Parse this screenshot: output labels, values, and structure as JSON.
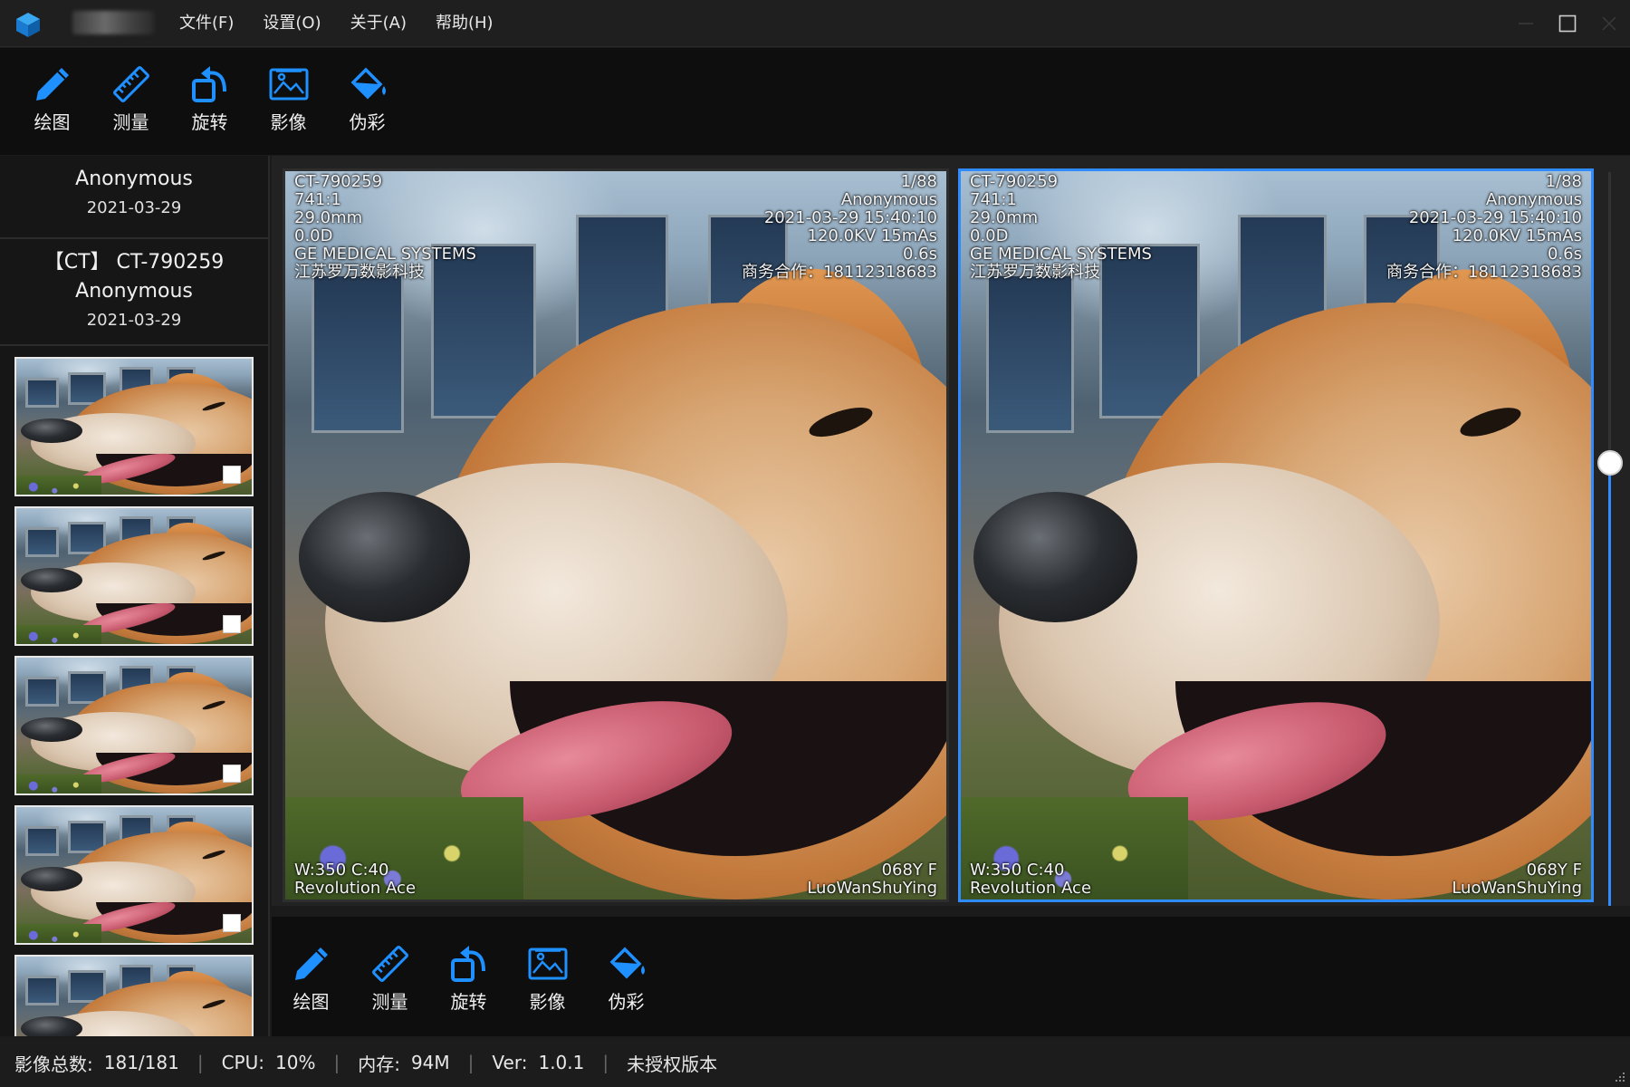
{
  "window": {
    "title": "L",
    "menu": [
      "文件(F)",
      "设置(O)",
      "关于(A)",
      "帮助(H)"
    ]
  },
  "toolbar_top": [
    {
      "label": "绘图",
      "icon": "pencil-icon"
    },
    {
      "label": "测量",
      "icon": "ruler-icon"
    },
    {
      "label": "旋转",
      "icon": "rotate-icon"
    },
    {
      "label": "影像",
      "icon": "image-icon"
    },
    {
      "label": "伪彩",
      "icon": "paint-bucket-icon"
    }
  ],
  "toolbar_bottom": [
    {
      "label": "绘图",
      "icon": "pencil-icon"
    },
    {
      "label": "测量",
      "icon": "ruler-icon"
    },
    {
      "label": "旋转",
      "icon": "rotate-icon"
    },
    {
      "label": "影像",
      "icon": "image-icon"
    },
    {
      "label": "伪彩",
      "icon": "paint-bucket-icon"
    }
  ],
  "patient": {
    "name": "Anonymous",
    "date": "2021-03-29"
  },
  "series": {
    "title": "【CT】 CT-790259",
    "name": "Anonymous",
    "date": "2021-03-29"
  },
  "thumbnails": [
    {
      "checked": false
    },
    {
      "checked": false
    },
    {
      "checked": false
    },
    {
      "checked": false
    },
    {
      "checked": false
    }
  ],
  "viewports": [
    {
      "active": false,
      "top_left": [
        "CT-790259",
        "741:1",
        "29.0mm",
        "0.0D",
        "GE MEDICAL SYSTEMS",
        "江苏罗万数影科技"
      ],
      "top_right": [
        "1/88",
        "Anonymous",
        "2021-03-29 15:40:10",
        "120.0KV 15mAs",
        "0.6s",
        "商务合作：18112318683"
      ],
      "bottom_left": [
        "W:350 C:40",
        "Revolution Ace"
      ],
      "bottom_right": [
        "068Y F",
        "LuoWanShuYing"
      ]
    },
    {
      "active": true,
      "top_left": [
        "CT-790259",
        "741:1",
        "29.0mm",
        "0.0D",
        "GE MEDICAL SYSTEMS",
        "江苏罗万数影科技"
      ],
      "top_right": [
        "1/88",
        "Anonymous",
        "2021-03-29 15:40:10",
        "120.0KV 15mAs",
        "0.6s",
        "商务合作：18112318683"
      ],
      "bottom_left": [
        "W:350 C:40",
        "Revolution Ace"
      ],
      "bottom_right": [
        "068Y F",
        "LuoWanShuYing"
      ]
    }
  ],
  "slider": {
    "level_fraction": 0.56
  },
  "status": {
    "total_label": "影像总数:",
    "total_value": "181/181",
    "cpu_label": "CPU:",
    "cpu_value": "10%",
    "mem_label": "内存:",
    "mem_value": "94M",
    "ver_label": "Ver:",
    "ver_value": "1.0.1",
    "license": "未授权版本"
  },
  "colors": {
    "accent": "#2f8bff",
    "icon_blue": "#1e90ff",
    "background": "#1b1b1b",
    "toolbar_bg": "#0e0e0e"
  }
}
